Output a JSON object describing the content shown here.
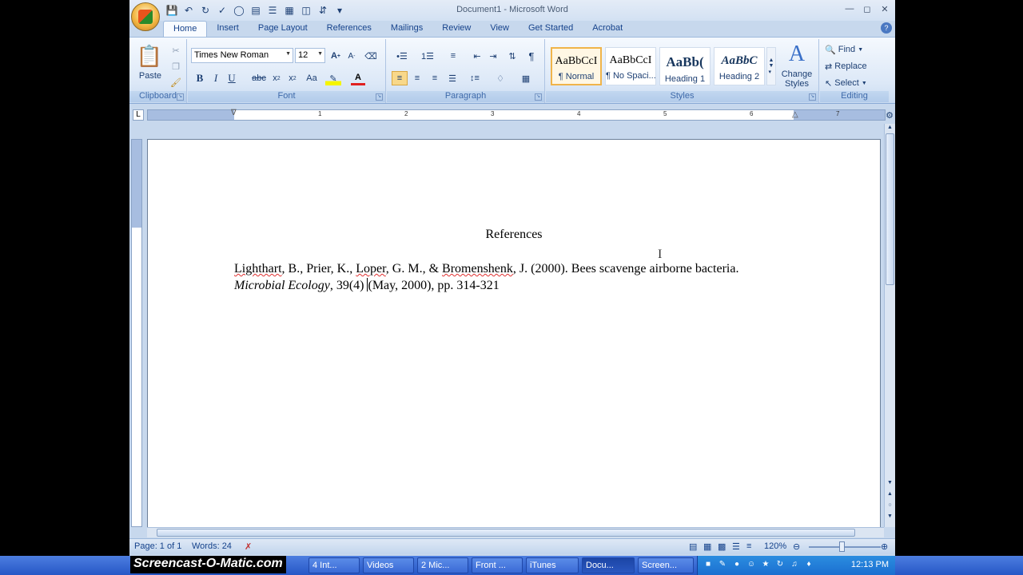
{
  "window": {
    "title": "Document1 - Microsoft Word"
  },
  "quick_access": [
    "save",
    "undo",
    "redo",
    "spelling",
    "print-preview"
  ],
  "tabs": [
    {
      "label": "Home",
      "active": true
    },
    {
      "label": "Insert"
    },
    {
      "label": "Page Layout"
    },
    {
      "label": "References"
    },
    {
      "label": "Mailings"
    },
    {
      "label": "Review"
    },
    {
      "label": "View"
    },
    {
      "label": "Get Started"
    },
    {
      "label": "Acrobat"
    }
  ],
  "ribbon": {
    "clipboard": {
      "label": "Clipboard",
      "paste": "Paste"
    },
    "font": {
      "label": "Font",
      "font_name": "Times New Roman",
      "font_size": "12"
    },
    "paragraph": {
      "label": "Paragraph"
    },
    "styles": {
      "label": "Styles",
      "tiles": [
        {
          "sample": "AaBbCcI",
          "name": "¶ Normal"
        },
        {
          "sample": "AaBbCcI",
          "name": "¶ No Spaci..."
        },
        {
          "sample": "AaBb(",
          "name": "Heading 1"
        },
        {
          "sample": "AaBbC",
          "name": "Heading 2"
        }
      ],
      "change_styles": "Change Styles"
    },
    "editing": {
      "label": "Editing",
      "find": "Find",
      "replace": "Replace",
      "select": "Select"
    }
  },
  "ruler": {
    "numbers": [
      "1",
      "2",
      "3",
      "4",
      "5",
      "6",
      "7"
    ]
  },
  "document": {
    "heading": "References",
    "ref": {
      "a1": "Lighthart",
      "a1_rest": ", B., Prier, K., ",
      "a2": "Loper",
      "a2_rest": ", G. M., & ",
      "a3": "Bromenshenk",
      "a3_rest": ", J. (2000). Bees scavenge airborne bacteria. ",
      "journal": "Microbial Ecology",
      "tail1": ", 39(4) ",
      "tail2": "(May, 2000), pp. 314-321"
    }
  },
  "status": {
    "page": "Page: 1 of 1",
    "words": "Words: 24",
    "zoom": "120%"
  },
  "taskbar": {
    "watermark": "Screencast-O-Matic.com",
    "items": [
      {
        "label": "4 Int..."
      },
      {
        "label": "Videos"
      },
      {
        "label": "2 Mic..."
      },
      {
        "label": "Front ..."
      },
      {
        "label": "iTunes"
      },
      {
        "label": "Docu..."
      },
      {
        "label": "Screen..."
      }
    ],
    "clock": "12:13 PM"
  }
}
